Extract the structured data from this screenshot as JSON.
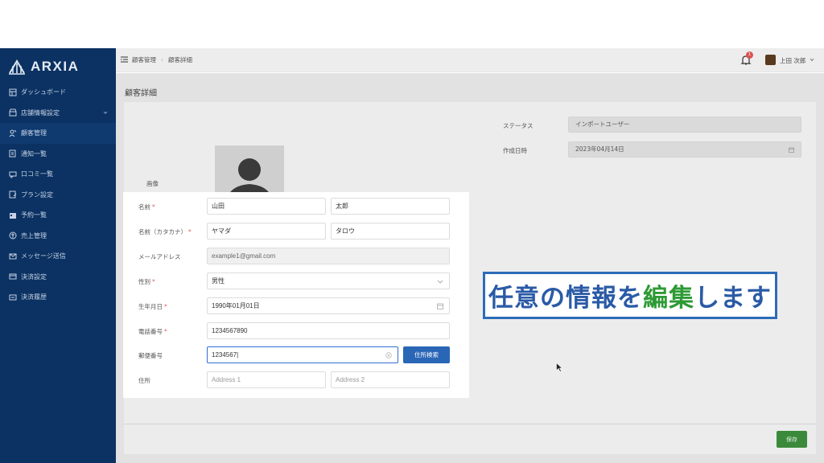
{
  "app": {
    "logo_text": "ARXIA"
  },
  "sidebar": {
    "items": [
      {
        "label": "ダッシュボード",
        "icon": "dashboard-icon"
      },
      {
        "label": "店舗情報設定",
        "icon": "store-icon",
        "has_chevron": true
      },
      {
        "label": "顧客管理",
        "icon": "customers-icon",
        "active": true
      },
      {
        "label": "通知一覧",
        "icon": "notification-list-icon"
      },
      {
        "label": "口コミ一覧",
        "icon": "review-icon"
      },
      {
        "label": "プラン設定",
        "icon": "plan-icon"
      },
      {
        "label": "予約一覧",
        "icon": "calendar-icon"
      },
      {
        "label": "売上管理",
        "icon": "sales-icon"
      },
      {
        "label": "メッセージ送信",
        "icon": "message-icon"
      },
      {
        "label": "決済設定",
        "icon": "payment-settings-icon"
      },
      {
        "label": "決済履歴",
        "icon": "payment-history-icon"
      }
    ]
  },
  "topbar": {
    "breadcrumb": [
      "顧客管理",
      "顧客詳細"
    ],
    "notification_count": "1",
    "user_name": "上田 次郎"
  },
  "page": {
    "title": "顧客詳細",
    "image_label": "画像",
    "save_label": "保存"
  },
  "meta_fields": {
    "status_label": "ステータス",
    "status_value": "インポートユーザー",
    "created_label": "作成日時",
    "created_value": "2023年04月14日"
  },
  "form": {
    "name_label": "名前",
    "last_name": "山田",
    "first_name": "太郎",
    "kana_label": "名前（カタカナ）",
    "last_kana": "ヤマダ",
    "first_kana": "タロウ",
    "email_label": "メールアドレス",
    "email": "example1@gmail.com",
    "gender_label": "性別",
    "gender": "男性",
    "birthday_label": "生年月日",
    "birthday": "1990年01月01日",
    "phone_label": "電話番号",
    "phone": "1234567890",
    "postal_label": "郵便番号",
    "postal": "1234567",
    "address_search_label": "住所検索",
    "address_label": "住所",
    "address1_placeholder": "Address 1",
    "address2_placeholder": "Address 2",
    "required_mark": "*"
  },
  "caption": {
    "part1": "任意の情報を",
    "part2": "編集",
    "part3": "します"
  },
  "colors": {
    "sidebar_bg": "#0b3262",
    "primary_button": "#2a66b6",
    "save_button": "#3b8a3b",
    "caption_blue": "#2a5aa6",
    "caption_green": "#2e9a35"
  }
}
